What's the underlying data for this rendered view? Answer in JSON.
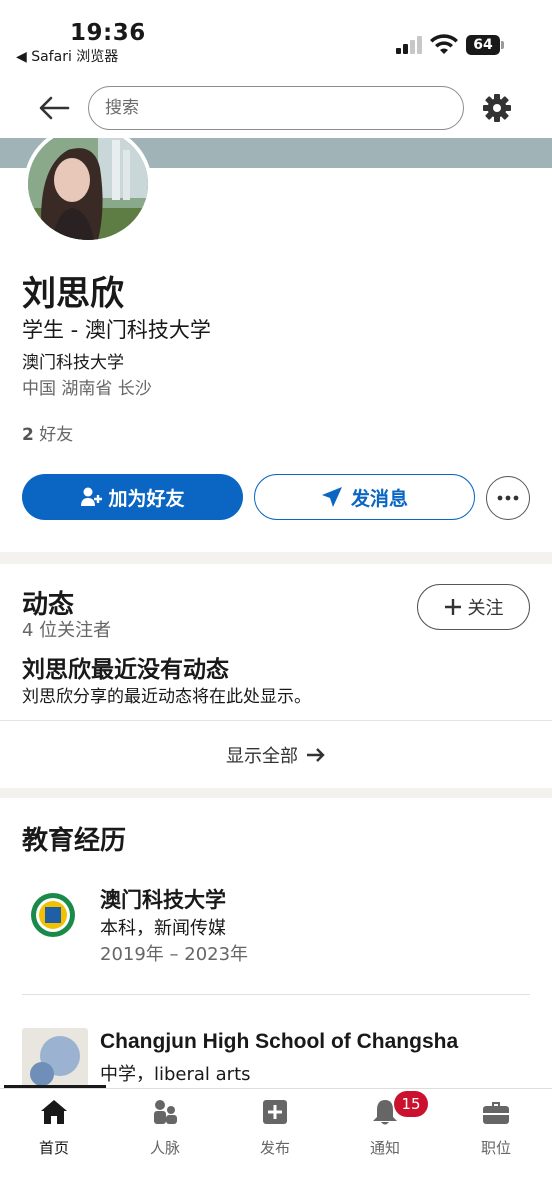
{
  "status_bar": {
    "time": "19:36",
    "back_app": "◀ Safari 浏览器",
    "battery": "64"
  },
  "top_nav": {
    "search_placeholder": "搜索"
  },
  "profile": {
    "name": "刘思欣",
    "headline": "学生 - 澳门科技大学",
    "school": "澳门科技大学",
    "location": "中国 湖南省 长沙",
    "friends_count": "2",
    "friends_label": "好友",
    "add_friend_label": "加为好友",
    "message_label": "发消息"
  },
  "activity": {
    "title": "动态",
    "followers": "4 位关注者",
    "follow_label": "关注",
    "empty_title": "刘思欣最近没有动态",
    "empty_desc": "刘思欣分享的最近动态将在此处显示。",
    "show_all_label": "显示全部"
  },
  "education": {
    "title": "教育经历",
    "items": [
      {
        "school": "澳门科技大学",
        "degree": "本科，新闻传媒",
        "dates": "2019年 – 2023年"
      },
      {
        "school": "Changjun High School of Changsha",
        "degree": "中学，liberal arts"
      }
    ]
  },
  "tab_bar": {
    "tabs": [
      {
        "label": "首页",
        "icon": "home-icon",
        "active": true
      },
      {
        "label": "人脉",
        "icon": "network-icon"
      },
      {
        "label": "发布",
        "icon": "post-icon"
      },
      {
        "label": "通知",
        "icon": "bell-icon"
      },
      {
        "label": "职位",
        "icon": "briefcase-icon"
      }
    ],
    "notification_badge": "15"
  },
  "colors": {
    "brand_blue": "#0a66c2",
    "badge_red": "#cb112d",
    "cover": "#a0b4b7"
  }
}
